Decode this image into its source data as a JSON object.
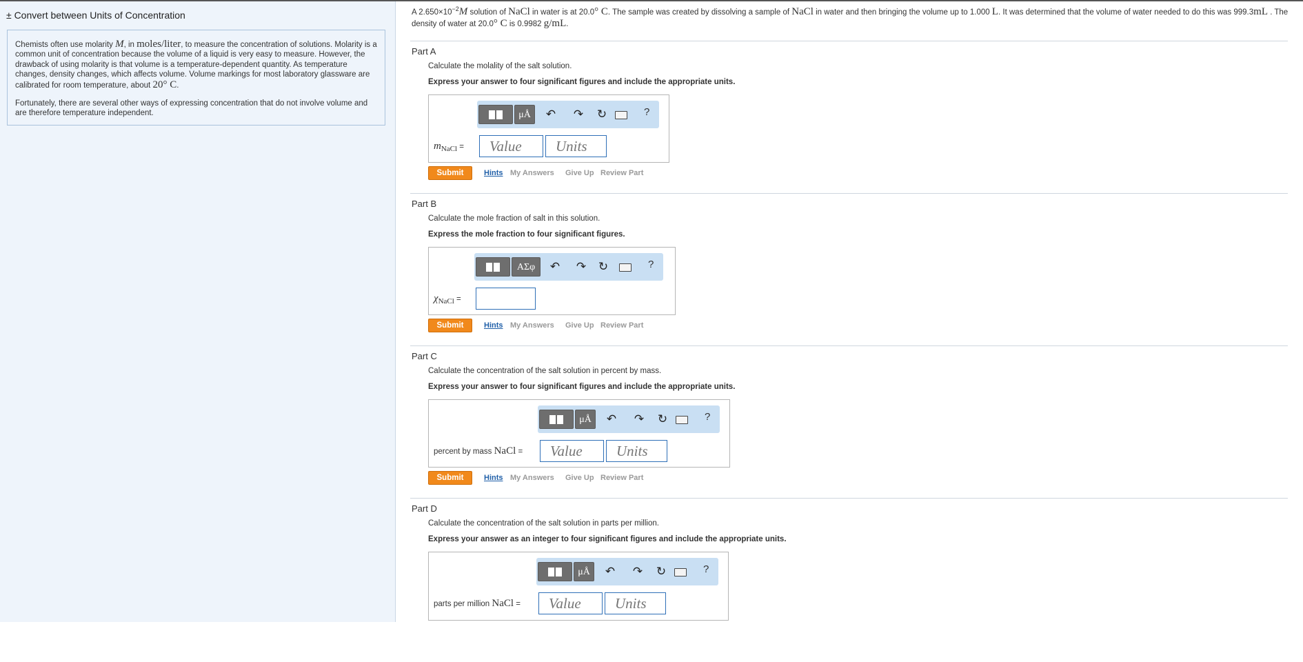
{
  "sidebar": {
    "title": "± Convert between Units of Concentration",
    "intro_p1_a": "Chemists often use molarity",
    "intro_p1_sym": "M",
    "intro_p1_b": ", in",
    "intro_p1_unit": "moles/liter",
    "intro_p1_c": ", to measure the concentration of solutions. Molarity is a common unit of concentration because the volume of a liquid is very easy to measure. However, the drawback of using molarity is that volume is a temperature-dependent quantity. As temperature changes, density changes, which affects volume. Volume markings for most laboratory glassware are calibrated for room temperature, about",
    "intro_p1_temp": "20° C",
    "intro_p1_end": ".",
    "intro_p2": "Fortunately, there are several other ways of expressing concentration that do not involve volume and are therefore temperature independent."
  },
  "problem": {
    "t1": "A 2.650×10",
    "exp": "−2",
    "t2": "M",
    "t3": " solution of ",
    "t4": "NaCl",
    "t5": " in water is at 20.0",
    "t6": "° C",
    "t7": ". The sample was created by dissolving a sample of ",
    "t8": "NaCl",
    "t9": " in water and then bringing the volume up to 1.000 ",
    "t10": "L",
    "t11": ". It was determined that the volume of water needed to do this was 999.3",
    "t12": "mL",
    "t13": " . The density of water at 20.0",
    "t14": "° C",
    "t15": " is 0.9982 ",
    "t16": "g/mL",
    "t17": "."
  },
  "toolbar": {
    "units_label": "μÅ",
    "greek_label": "ΑΣφ",
    "help_label": "?",
    "undo_icon": "undo-icon",
    "redo_icon": "redo-icon",
    "reset_icon": "reset-icon",
    "keyboard_icon": "keyboard-icon"
  },
  "links": {
    "submit": "Submit",
    "hints": "Hints",
    "my_answers": "My Answers",
    "give_up": "Give Up",
    "review_part": "Review Part"
  },
  "placeholders": {
    "value": "Value",
    "units": "Units"
  },
  "parts": [
    {
      "title": "Part A",
      "prompt": "Calculate the molality of the salt solution.",
      "instruction": "Express your answer to four significant figures and include the appropriate units.",
      "label_sym": "m",
      "label_sub": "NaCl",
      "label_eq": " ="
    },
    {
      "title": "Part B",
      "prompt": "Calculate the mole fraction of salt in this solution.",
      "instruction": "Express the mole fraction to four significant figures.",
      "label_sym": "χ",
      "label_sub": "NaCl",
      "label_eq": " ="
    },
    {
      "title": "Part C",
      "prompt": "Calculate the concentration of the salt solution in percent by mass.",
      "instruction": "Express your answer to four significant figures and include the appropriate units.",
      "label_text": "percent by mass ",
      "label_formula": "NaCl",
      "label_eq": " ="
    },
    {
      "title": "Part D",
      "prompt": "Calculate the concentration of the salt solution in parts per million.",
      "instruction": "Express your answer as an integer to four significant figures and include the appropriate units.",
      "label_text": "parts per million ",
      "label_formula": "NaCl",
      "label_eq": " ="
    }
  ],
  "colors": {
    "sidebar_bg": "#eef4fb",
    "toolbar_bg": "#c9dff3",
    "submit_bg": "#f1891b",
    "field_border": "#2e6fb7",
    "hints_link": "#1f5fa8"
  }
}
